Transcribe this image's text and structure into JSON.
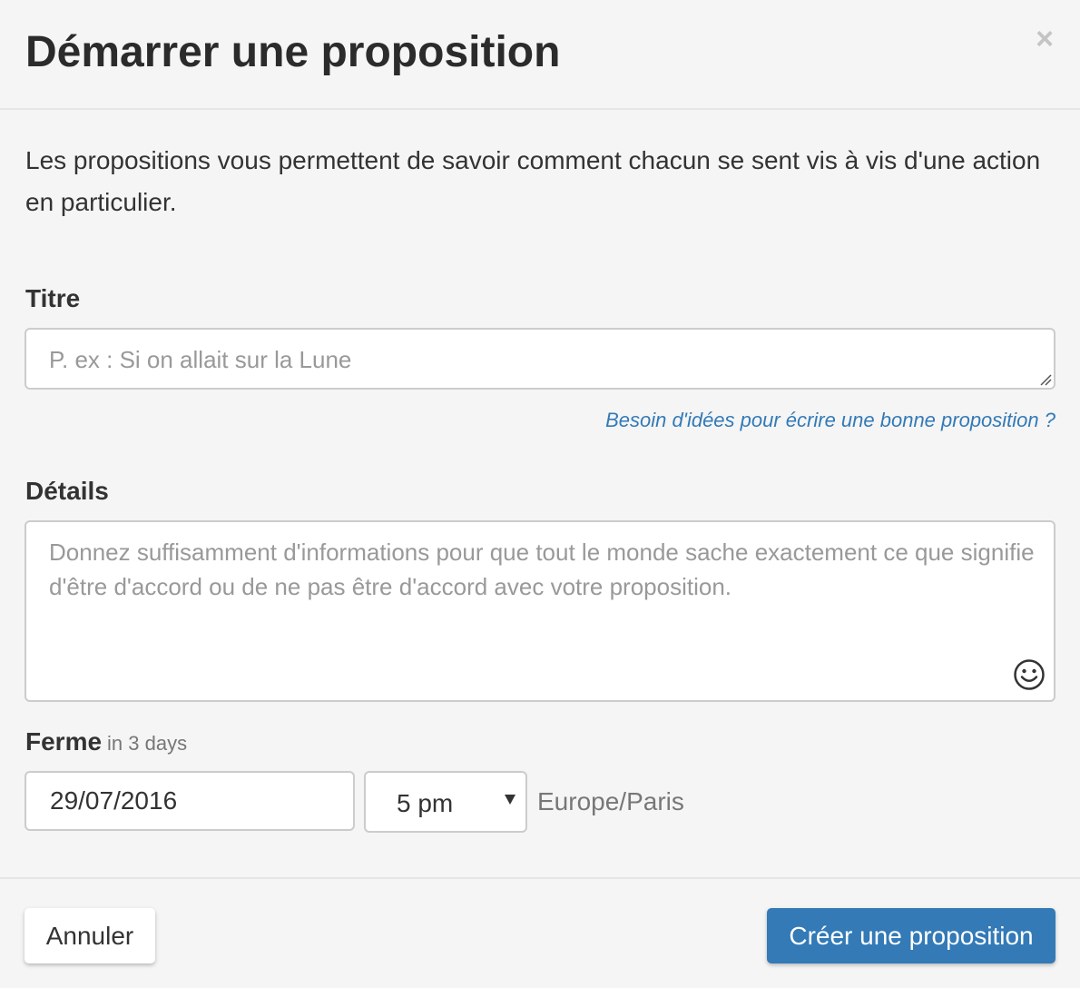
{
  "header": {
    "title": "Démarrer une proposition",
    "close_label": "×"
  },
  "intro": "Les propositions vous permettent de savoir comment chacun se sent vis à vis d'une action en particulier.",
  "title_field": {
    "label": "Titre",
    "placeholder": "P. ex : Si on allait sur la Lune",
    "value": ""
  },
  "help_link": "Besoin d'idées pour écrire une bonne proposition ?",
  "details_field": {
    "label": "Détails",
    "placeholder": "Donnez suffisamment d'informations pour que tout le monde sache exactement ce que signifie d'être d'accord ou de ne pas être d'accord avec votre proposition.",
    "value": "",
    "emoji_icon": "smiley-icon"
  },
  "closes": {
    "label": "Ferme",
    "hint": "in 3 days",
    "date": "29/07/2016",
    "time": "5 pm",
    "timezone": "Europe/Paris"
  },
  "footer": {
    "cancel_label": "Annuler",
    "submit_label": "Créer une proposition"
  },
  "colors": {
    "primary": "#337ab7",
    "background": "#f5f5f5",
    "border": "#cccccc",
    "link": "#337ab7"
  }
}
